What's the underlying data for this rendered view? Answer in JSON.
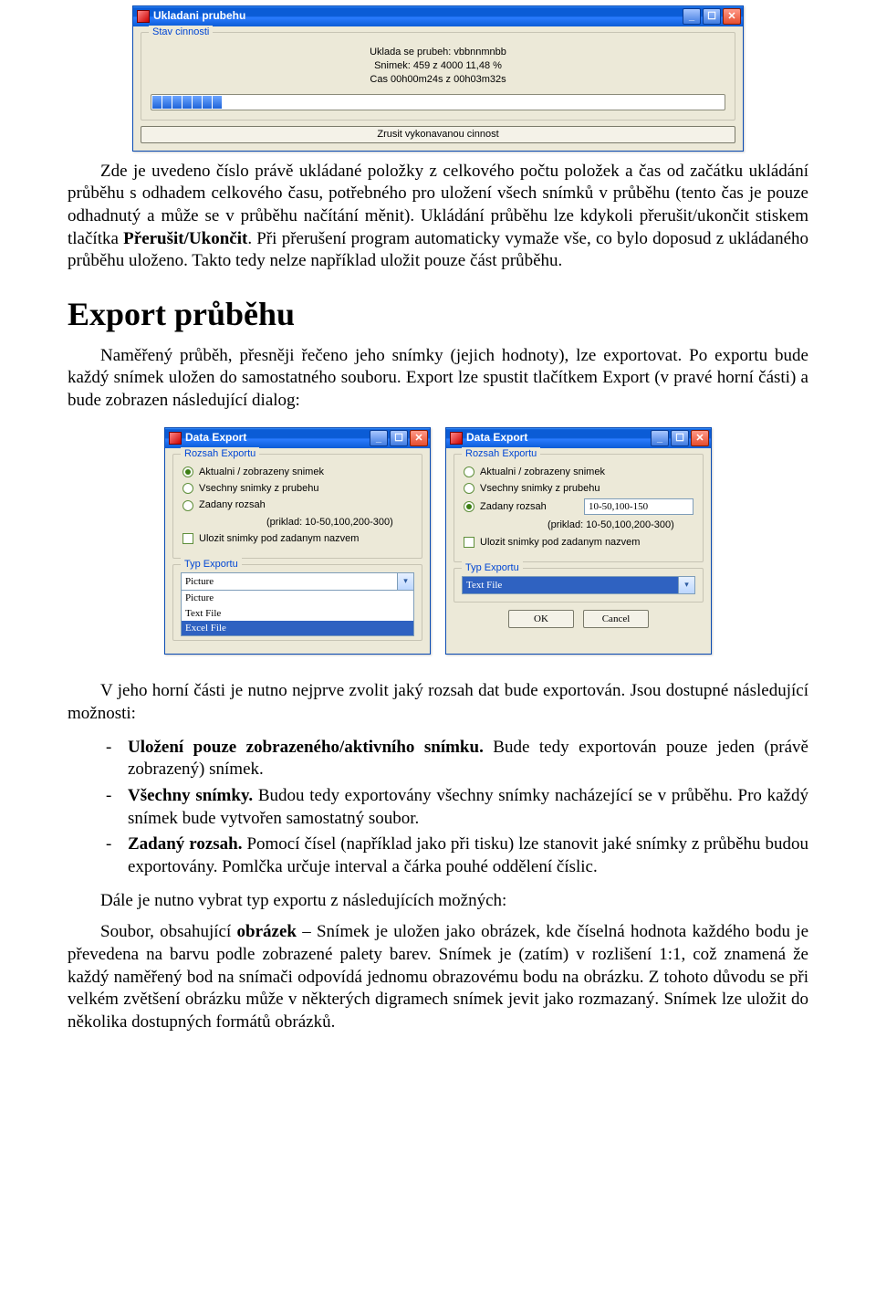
{
  "top_window": {
    "title": "Ukladani prubehu",
    "group_legend": "Stav cinnosti",
    "status_line1": "Uklada se prubeh: vbbnnmnbb",
    "status_line2": "Snimek: 459 z 4000   11,48 %",
    "status_line3": "Cas 00h00m24s z 00h03m32s",
    "cancel_button": "Zrusit vykonavanou cinnost"
  },
  "para1_a": "Zde je uvedeno číslo právě ukládané položky z celkového počtu položek a čas od začátku ukládání průběhu s odhadem celkového času, potřebného pro uložení všech snímků v průběhu (tento čas je pouze odhadnutý a může se v průběhu načítání měnit). Ukládání průběhu lze kdykoli přerušit/ukončit stiskem tlačítka ",
  "para1_bold": "Přerušit/Ukončit",
  "para1_b": ". Při přerušení program automaticky vymaže vše, co bylo doposud z ukládaného průběhu uloženo. Takto tedy nelze například uložit pouze část průběhu.",
  "heading_export": "Export průběhu",
  "para2": "Naměřený průběh, přesněji řečeno jeho snímky (jejich hodnoty), lze exportovat. Po exportu bude každý snímek uložen do samostatného souboru. Export lze spustit tlačítkem Export (v pravé horní části) a bude zobrazen následující dialog:",
  "export_dialog": {
    "title": "Data Export",
    "group_rozsah": "Rozsah Exportu",
    "opt_aktualni": "Aktualni / zobrazeny snimek",
    "opt_vsechny": "Vsechny snimky z prubehu",
    "opt_zadany": "Zadany rozsah",
    "range_value": "10-50,100-150",
    "hint": "(priklad: 10-50,100,200-300)",
    "chk_ulozit": "Ulozit snimky pod zadanym nazvem",
    "group_typ": "Typ Exportu",
    "type_picture": "Picture",
    "type_text": "Text File",
    "type_excel": "Excel File",
    "btn_ok": "OK",
    "btn_cancel": "Cancel"
  },
  "para3": "V jeho horní části je nutno nejprve zvolit jaký rozsah dat bude exportován. Jsou dostupné následující možnosti:",
  "bullets": {
    "b1_bold": "Uložení pouze zobrazeného/aktivního snímku.",
    "b1_rest": " Bude tedy exportován pouze jeden (právě zobrazený) snímek.",
    "b2_bold": "Všechny snímky.",
    "b2_rest": " Budou tedy exportovány všechny snímky nacházející se v průběhu. Pro každý snímek bude vytvořen samostatný soubor.",
    "b3_bold": "Zadaný rozsah.",
    "b3_rest": " Pomocí čísel (například jako při tisku) lze stanovit jaké snímky z průběhu budou exportovány. Pomlčka určuje interval a čárka pouhé oddělení číslic."
  },
  "para4_a": "Dále je nutno vybrat typ exportu z následujících možných:",
  "para4_b_pre": "Soubor, obsahující ",
  "para4_b_bold": "obrázek",
  "para4_b_post": " – Snímek je uložen jako obrázek, kde číselná hodnota každého bodu je převedena na barvu podle zobrazené palety barev. Snímek je (zatím) v rozlišení 1:1, což znamená že každý naměřený bod na snímači odpovídá jednomu obrazovému bodu na obrázku. Z tohoto důvodu se při velkém zvětšení obrázku může v některých digramech snímek jevit jako rozmazaný. Snímek lze uložit do několika dostupných formátů obrázků."
}
